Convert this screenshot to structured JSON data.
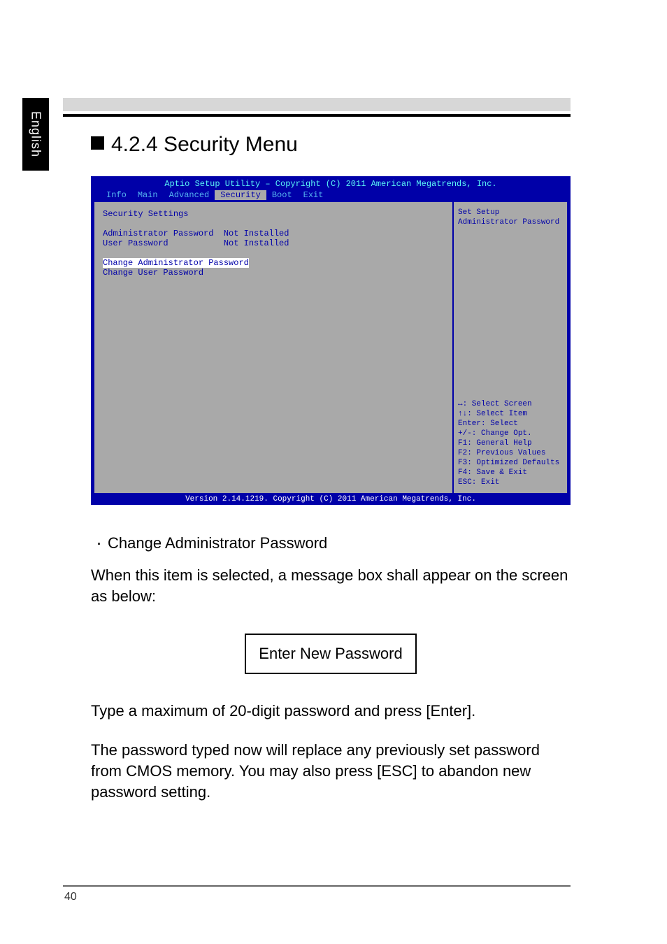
{
  "sidetab": "English",
  "heading": "4.2.4 Security Menu",
  "bios": {
    "title": "Aptio Setup Utility – Copyright (C) 2011 American Megatrends, Inc.",
    "tabs": [
      "Info",
      "Main",
      "Advanced",
      "Security",
      "Boot",
      "Exit"
    ],
    "active_tab": "Security",
    "left": {
      "section": "Security Settings",
      "rows": [
        {
          "label": "Administrator Password",
          "value": "Not Installed"
        },
        {
          "label": "User Password",
          "value": "Not Installed"
        }
      ],
      "actions": [
        "Change Administrator Password",
        "Change User Password"
      ]
    },
    "right": {
      "help": "Set Setup Administrator Password",
      "keys": [
        "↔: Select Screen",
        "↑↓: Select Item",
        "Enter: Select",
        "+/-: Change Opt.",
        "F1: General Help",
        "F2: Previous Values",
        "F3: Optimized Defaults",
        "F4: Save & Exit",
        "ESC: Exit"
      ]
    },
    "footer": "Version 2.14.1219. Copyright (C) 2011 American Megatrends, Inc."
  },
  "bullet1": "Change Administrator Password",
  "para1": "When this item is selected, a message box shall appear on the screen as below:",
  "box": "Enter New Password",
  "para2": "Type a maximum of 20-digit password and press [Enter].",
  "para3": "The password typed now will replace any previously set password from CMOS memory. You may also press [ESC] to abandon new password setting.",
  "pagenum": "40"
}
